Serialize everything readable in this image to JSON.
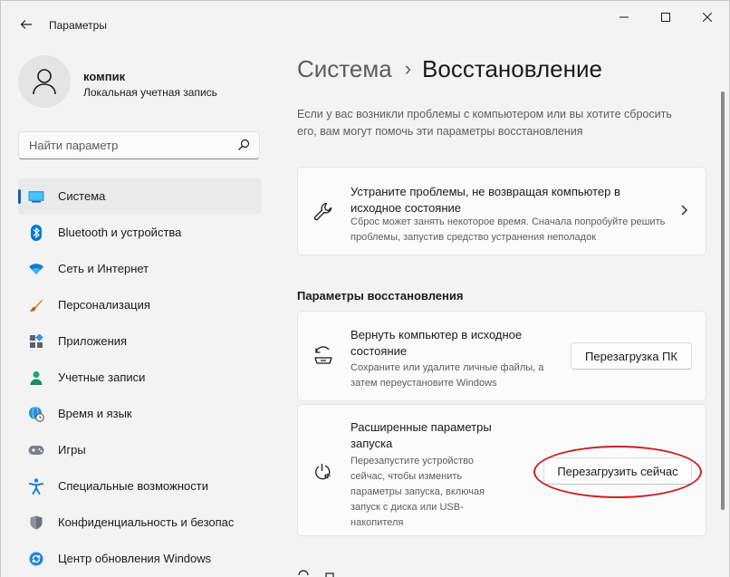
{
  "app": {
    "title": "Параметры",
    "back_icon": "arrow-left-icon"
  },
  "window_controls": {
    "minimize_icon": "minimize-icon",
    "maximize_icon": "maximize-icon",
    "close_icon": "close-icon"
  },
  "profile": {
    "name": "компик",
    "account_type": "Локальная учетная запись"
  },
  "search": {
    "placeholder": "Найти параметр",
    "value": ""
  },
  "sidebar": {
    "items": [
      {
        "label": "Система",
        "icon": "system-display-icon",
        "active": true
      },
      {
        "label": "Bluetooth и устройства",
        "icon": "bluetooth-icon",
        "active": false
      },
      {
        "label": "Сеть и Интернет",
        "icon": "wifi-icon",
        "active": false
      },
      {
        "label": "Персонализация",
        "icon": "brush-icon",
        "active": false
      },
      {
        "label": "Приложения",
        "icon": "apps-icon",
        "active": false
      },
      {
        "label": "Учетные записи",
        "icon": "person-icon",
        "active": false
      },
      {
        "label": "Время и язык",
        "icon": "globe-clock-icon",
        "active": false
      },
      {
        "label": "Игры",
        "icon": "gamepad-icon",
        "active": false
      },
      {
        "label": "Специальные возможности",
        "icon": "accessibility-icon",
        "active": false
      },
      {
        "label": "Конфиденциальность и безопас",
        "icon": "shield-icon",
        "active": false
      },
      {
        "label": "Центр обновления Windows",
        "icon": "update-icon",
        "active": false
      }
    ]
  },
  "breadcrumb": {
    "parent": "Система",
    "separator": "›",
    "current": "Восстановление"
  },
  "intro": {
    "text": "Если у вас возникли проблемы с компьютером или вы хотите сбросить его, вам могут помочь эти параметры восстановления"
  },
  "troubleshoot_card": {
    "icon": "wrench-icon",
    "title": "Устраните проблемы, не возвращая компьютер в исходное состояние",
    "description": "Сброс может занять некоторое время. Сначала попробуйте решить проблемы, запустив средство устранения неполадок",
    "chevron_icon": "chevron-right-icon"
  },
  "recovery_section": {
    "title": "Параметры восстановления",
    "reset_card": {
      "icon": "reset-pc-icon",
      "title": "Вернуть компьютер в исходное состояние",
      "description": "Сохраните или удалите личные файлы, а затем переустановите Windows",
      "button": "Перезагрузка ПК"
    },
    "advanced_card": {
      "icon": "restart-power-icon",
      "title": "Расширенные параметры запуска",
      "description": "Перезапустите устройство сейчас, чтобы изменить параметры запуска, включая запуск с диска или USB-накопителя",
      "button": "Перезагрузить сейчас"
    }
  },
  "colors": {
    "accent": "#0067c0",
    "annotation": "#cc1f1f",
    "background": "#f3f3f3",
    "card": "#fbfbfb"
  }
}
